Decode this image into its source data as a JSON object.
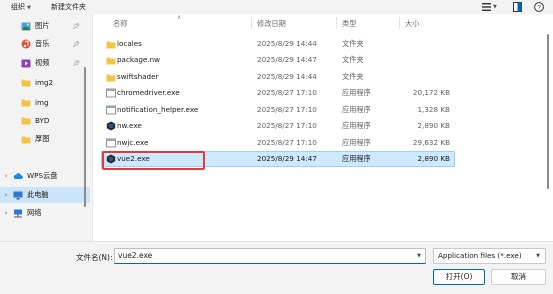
{
  "toolbar": {
    "organize_label": "组织",
    "new_folder_label": "新建文件夹",
    "view_icon": "view-options-icon",
    "preview_icon": "preview-pane-icon",
    "help_icon": "help-icon"
  },
  "sidebar": {
    "items": [
      {
        "label": "图片",
        "icon": "pictures-icon",
        "pinned": true,
        "expandable": false
      },
      {
        "label": "音乐",
        "icon": "music-icon",
        "pinned": true,
        "expandable": false
      },
      {
        "label": "视频",
        "icon": "videos-icon",
        "pinned": true,
        "expandable": false
      },
      {
        "label": "img2",
        "icon": "folder-icon",
        "pinned": false,
        "expandable": false
      },
      {
        "label": "img",
        "icon": "folder-icon",
        "pinned": false,
        "expandable": false
      },
      {
        "label": "BYD",
        "icon": "folder-icon",
        "pinned": false,
        "expandable": false
      },
      {
        "label": "厚图",
        "icon": "folder-icon",
        "pinned": false,
        "expandable": false
      },
      {
        "label": "WPS云盘",
        "icon": "cloud-icon",
        "pinned": false,
        "expandable": true
      },
      {
        "label": "此电脑",
        "icon": "computer-icon",
        "pinned": false,
        "expandable": true
      },
      {
        "label": "网络",
        "icon": "network-icon",
        "pinned": false,
        "expandable": true
      }
    ]
  },
  "columns": {
    "name": "名称",
    "modified": "修改日期",
    "type": "类型",
    "size": "大小"
  },
  "files": [
    {
      "name": "locales",
      "modified": "2025/8/29 14:44",
      "type": "文件夹",
      "size": "",
      "icon": "folder-icon"
    },
    {
      "name": "package.nw",
      "modified": "2025/8/29 14:47",
      "type": "文件夹",
      "size": "",
      "icon": "folder-icon"
    },
    {
      "name": "swiftshader",
      "modified": "2025/8/29 14:44",
      "type": "文件夹",
      "size": "",
      "icon": "folder-icon"
    },
    {
      "name": "chromedriver.exe",
      "modified": "2025/8/27 17:10",
      "type": "应用程序",
      "size": "20,172 KB",
      "icon": "exe-icon"
    },
    {
      "name": "notification_helper.exe",
      "modified": "2025/8/27 17:10",
      "type": "应用程序",
      "size": "1,328 KB",
      "icon": "exe-icon"
    },
    {
      "name": "nw.exe",
      "modified": "2025/8/27 17:10",
      "type": "应用程序",
      "size": "2,890 KB",
      "icon": "nw-app-icon"
    },
    {
      "name": "nwjc.exe",
      "modified": "2025/8/27 17:10",
      "type": "应用程序",
      "size": "29,632 KB",
      "icon": "exe-icon"
    },
    {
      "name": "vue2.exe",
      "modified": "2025/8/29 14:47",
      "type": "应用程序",
      "size": "2,890 KB",
      "icon": "nw-app-icon",
      "selected": true
    }
  ],
  "footer": {
    "filename_label": "文件名(N):",
    "filename_value": "vue2.exe",
    "filetype_value": "Application files (*.exe)",
    "open_label": "打开(O)",
    "cancel_label": "取消"
  },
  "colors": {
    "selection_bg": "#cde8ff",
    "selection_border": "#99d1ff",
    "highlight_box": "#e53935",
    "folder": "#f4c542",
    "accent": "#0067c0"
  }
}
